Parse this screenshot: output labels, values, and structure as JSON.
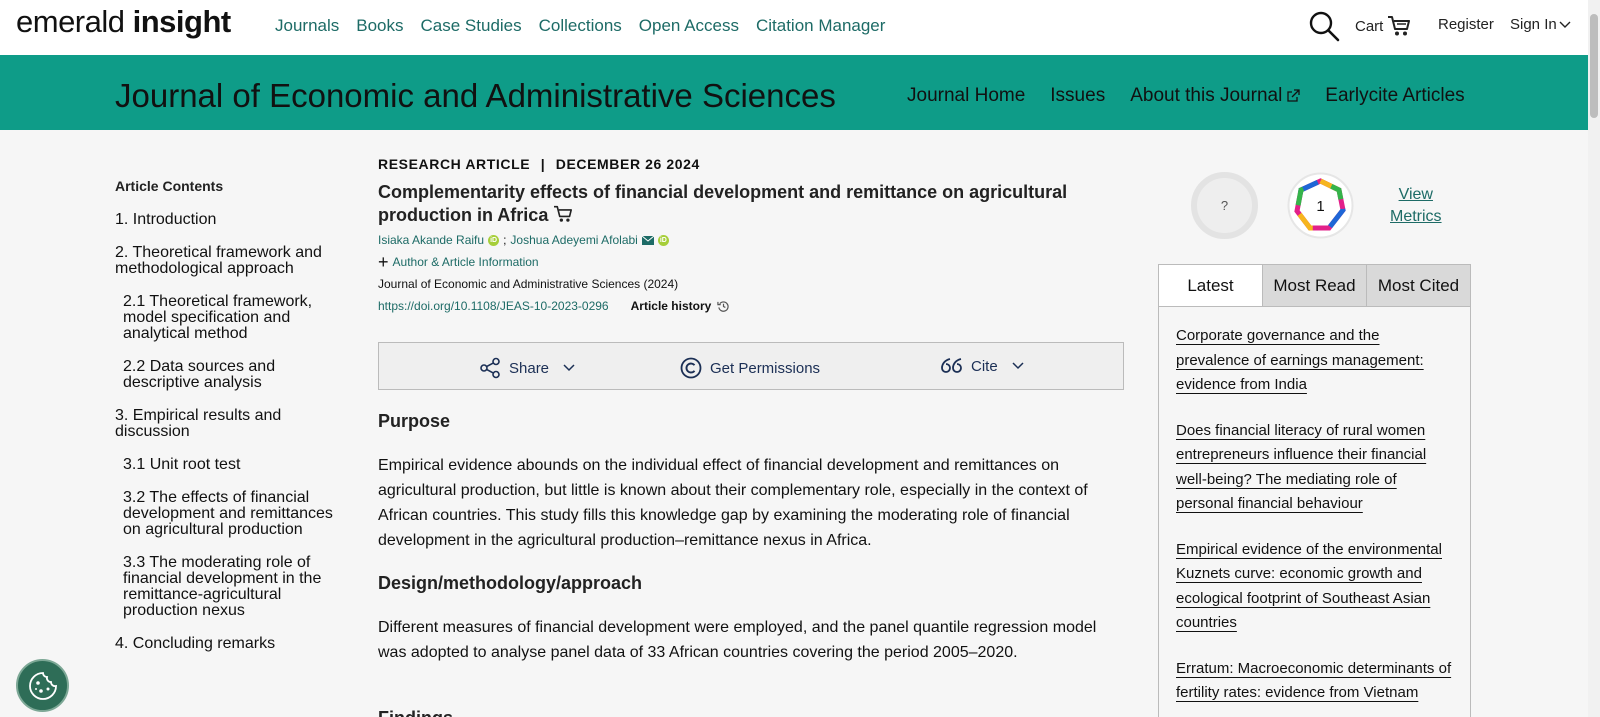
{
  "topnav": {
    "logo_part1": "emerald",
    "logo_part2": "insight",
    "links": [
      "Journals",
      "Books",
      "Case Studies",
      "Collections",
      "Open Access",
      "Citation Manager"
    ],
    "cart_label": "Cart",
    "register_label": "Register",
    "signin_label": "Sign In"
  },
  "journal": {
    "title": "Journal of Economic and Administrative Sciences",
    "nav": [
      "Journal Home",
      "Issues",
      "About this Journal",
      "Earlycite Articles"
    ]
  },
  "toc": {
    "heading": "Article Contents",
    "items": [
      {
        "label": "1. Introduction",
        "sub": false
      },
      {
        "label": "2. Theoretical framework and methodological approach",
        "sub": false
      },
      {
        "label": "2.1 Theoretical framework, model specification and analytical method",
        "sub": true
      },
      {
        "label": "2.2 Data sources and descriptive analysis",
        "sub": true
      },
      {
        "label": "3. Empirical results and discussion",
        "sub": false
      },
      {
        "label": "3.1 Unit root test",
        "sub": true
      },
      {
        "label": "3.2 The effects of financial development and remittances on agricultural production",
        "sub": true
      },
      {
        "label": "3.3 The moderating role of financial development in the remittance-agricultural production nexus",
        "sub": true
      },
      {
        "label": "4. Concluding remarks",
        "sub": false
      }
    ]
  },
  "article": {
    "type": "RESEARCH ARTICLE",
    "separator": "|",
    "date": "DECEMBER 26 2024",
    "title": "Complementarity effects of financial development and remittance on agricultural production in Africa",
    "author1": "Isiaka Akande Raifu",
    "author_sep": ";",
    "author2": "Joshua Adeyemi Afolabi",
    "author_info_label": "Author & Article Information",
    "journal_ref": "Journal of Economic and Administrative Sciences (2024)",
    "doi": "https://doi.org/10.1108/JEAS-10-2023-0296",
    "history_label": "Article history",
    "actions": {
      "share": "Share",
      "permissions": "Get Permissions",
      "cite": "Cite"
    },
    "sections": {
      "purpose_h": "Purpose",
      "purpose": "Empirical evidence abounds on the individual effect of financial development and remittances on agricultural production, but little is known about their complementary role, especially in the context of African countries. This study fills this knowledge gap by examining the moderating role of financial development in the agricultural production–remittance nexus in Africa.",
      "design_h": "Design/methodology/approach",
      "design": "Different measures of financial development were employed, and the panel quantile regression model was adopted to analyse panel data of 33 African countries covering the period 2005–2020.",
      "findings_h": "Findings"
    }
  },
  "metrics": {
    "unknown_badge": "?",
    "dimensions_count": "1",
    "view_label_1": "View",
    "view_label_2": "Metrics"
  },
  "sidebar": {
    "tabs": [
      "Latest",
      "Most Read",
      "Most Cited"
    ],
    "articles": [
      "Corporate governance and the prevalence of earnings management: evidence from India",
      "Does financial literacy of rural women entrepreneurs influence their financial well-being? The mediating role of personal financial behaviour",
      "Empirical evidence of the environmental Kuznets curve: economic growth and ecological footprint of Southeast Asian countries",
      "Erratum: Macroeconomic determinants of fertility rates: evidence from Vietnam"
    ]
  },
  "colors": {
    "brand_teal": "#0e9c88",
    "link_teal": "#1d6b66",
    "cookie_green": "#2e6d57"
  }
}
